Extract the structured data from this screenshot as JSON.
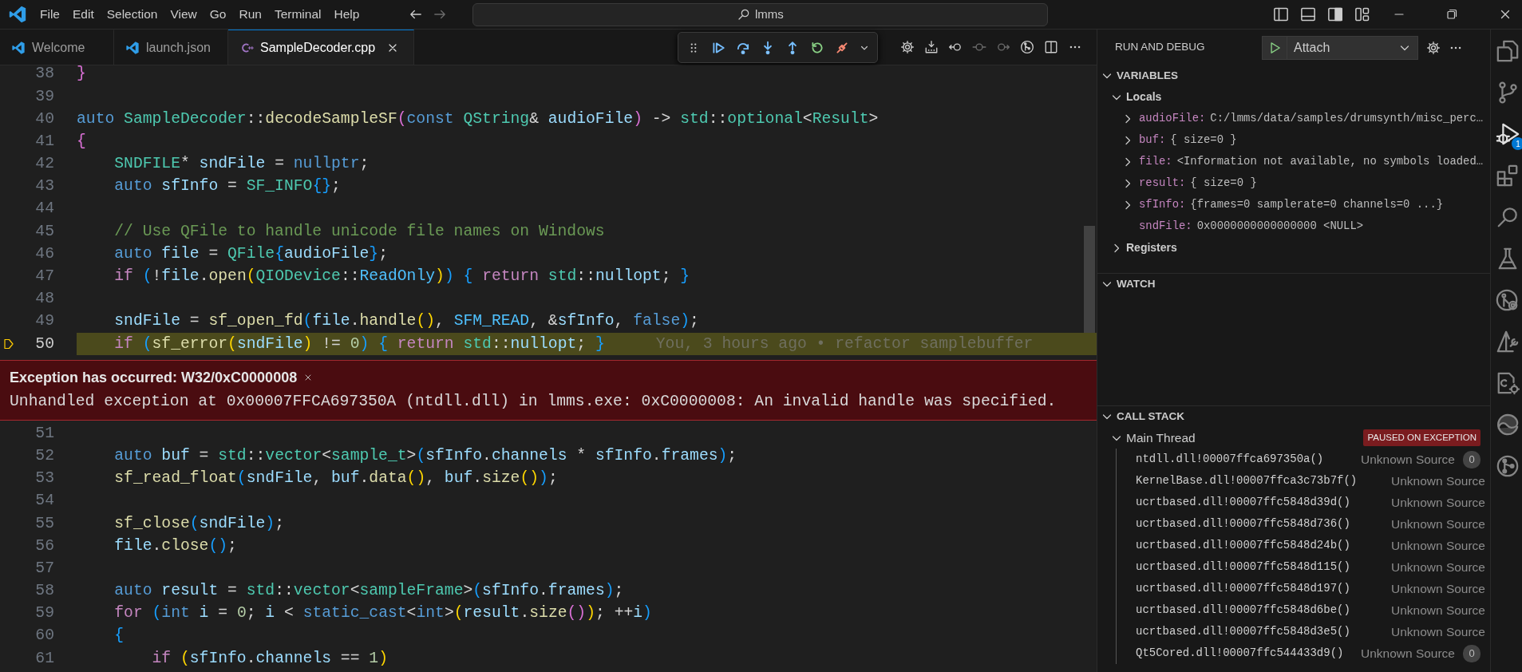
{
  "title_bar": {
    "menu": [
      "File",
      "Edit",
      "Selection",
      "View",
      "Go",
      "Run",
      "Terminal",
      "Help"
    ],
    "search": {
      "value": "lmms"
    }
  },
  "tabs": [
    {
      "label": "Welcome",
      "kind": "vscode",
      "selected": false
    },
    {
      "label": "launch.json",
      "kind": "vscode",
      "selected": false
    },
    {
      "label": "SampleDecoder.cpp",
      "kind": "cpp",
      "selected": true
    }
  ],
  "editor": {
    "lines": [
      {
        "number": "38",
        "current": false,
        "tokens": [
          {
            "kind": "b2",
            "text": "}"
          }
        ]
      },
      {
        "number": "39",
        "current": false
      },
      {
        "number": "40",
        "current": false,
        "tokens": [
          {
            "kind": "kw",
            "text": "auto"
          },
          {
            "kind": "type",
            "text": " SampleDecoder"
          },
          {
            "kind": "op",
            "text": "::"
          },
          {
            "kind": "fn",
            "text": "decodeSampleSF"
          },
          {
            "kind": "b2",
            "text": "("
          },
          {
            "kind": "kw",
            "text": "const"
          },
          {
            "kind": "type",
            "text": " QString"
          },
          {
            "kind": "op",
            "text": "& "
          },
          {
            "kind": "var",
            "text": "audioFile"
          },
          {
            "kind": "b2",
            "text": ")"
          },
          {
            "kind": "op",
            "text": " -> "
          },
          {
            "kind": "type",
            "text": "std"
          },
          {
            "kind": "op",
            "text": "::"
          },
          {
            "kind": "type",
            "text": "optional"
          },
          {
            "kind": "op",
            "text": "<"
          },
          {
            "kind": "type",
            "text": "Result"
          },
          {
            "kind": "op",
            "text": ">"
          }
        ]
      },
      {
        "number": "41",
        "current": false,
        "tokens": [
          {
            "kind": "b2",
            "text": "{"
          }
        ]
      },
      {
        "number": "42",
        "current": false,
        "tokens": [
          {
            "kind": "type",
            "text": "    SNDFILE"
          },
          {
            "kind": "op",
            "text": "* "
          },
          {
            "kind": "var",
            "text": "sndFile"
          },
          {
            "kind": "op",
            "text": " = "
          },
          {
            "kind": "kw",
            "text": "nullptr"
          },
          {
            "kind": "op",
            "text": ";"
          }
        ]
      },
      {
        "number": "43",
        "current": false,
        "tokens": [
          {
            "kind": "kw",
            "text": "    auto"
          },
          {
            "kind": "var",
            "text": " sfInfo"
          },
          {
            "kind": "op",
            "text": " = "
          },
          {
            "kind": "type",
            "text": "SF_INFO"
          },
          {
            "kind": "b3",
            "text": "{}"
          },
          {
            "kind": "op",
            "text": ";"
          }
        ]
      },
      {
        "number": "44",
        "current": false
      },
      {
        "number": "45",
        "current": false,
        "tokens": [
          {
            "kind": "com",
            "text": "    // Use QFile to handle unicode file names on Windows"
          }
        ]
      },
      {
        "number": "46",
        "current": false,
        "tokens": [
          {
            "kind": "kw",
            "text": "    auto"
          },
          {
            "kind": "var",
            "text": " file"
          },
          {
            "kind": "op",
            "text": " = "
          },
          {
            "kind": "type",
            "text": "QFile"
          },
          {
            "kind": "b3",
            "text": "{"
          },
          {
            "kind": "var",
            "text": "audioFile"
          },
          {
            "kind": "b3",
            "text": "}"
          },
          {
            "kind": "op",
            "text": ";"
          }
        ]
      },
      {
        "number": "47",
        "current": false,
        "tokens": [
          {
            "kind": "ctl",
            "text": "    if"
          },
          {
            "kind": "b3",
            "text": " ("
          },
          {
            "kind": "op",
            "text": "!"
          },
          {
            "kind": "var",
            "text": "file"
          },
          {
            "kind": "op",
            "text": "."
          },
          {
            "kind": "fn",
            "text": "open"
          },
          {
            "kind": "b1",
            "text": "("
          },
          {
            "kind": "type",
            "text": "QIODevice"
          },
          {
            "kind": "op",
            "text": "::"
          },
          {
            "kind": "enum",
            "text": "ReadOnly"
          },
          {
            "kind": "b1",
            "text": ")"
          },
          {
            "kind": "b3",
            "text": ")"
          },
          {
            "kind": "b3",
            "text": " {"
          },
          {
            "kind": "ctl",
            "text": " return"
          },
          {
            "kind": "type",
            "text": " std"
          },
          {
            "kind": "op",
            "text": "::"
          },
          {
            "kind": "var",
            "text": "nullopt"
          },
          {
            "kind": "op",
            "text": "; "
          },
          {
            "kind": "b3",
            "text": "}"
          }
        ]
      },
      {
        "number": "48",
        "current": false
      },
      {
        "number": "49",
        "current": false,
        "tokens": [
          {
            "kind": "var",
            "text": "    sndFile"
          },
          {
            "kind": "op",
            "text": " = "
          },
          {
            "kind": "fn",
            "text": "sf_open_fd"
          },
          {
            "kind": "b3",
            "text": "("
          },
          {
            "kind": "var",
            "text": "file"
          },
          {
            "kind": "op",
            "text": "."
          },
          {
            "kind": "fn",
            "text": "handle"
          },
          {
            "kind": "b1",
            "text": "()"
          },
          {
            "kind": "op",
            "text": ", "
          },
          {
            "kind": "enum",
            "text": "SFM_READ"
          },
          {
            "kind": "op",
            "text": ", &"
          },
          {
            "kind": "var",
            "text": "sfInfo"
          },
          {
            "kind": "op",
            "text": ", "
          },
          {
            "kind": "kw",
            "text": "false"
          },
          {
            "kind": "b3",
            "text": ")"
          },
          {
            "kind": "op",
            "text": ";"
          }
        ]
      },
      {
        "number": "50",
        "current": true,
        "annotation": "You, 3 hours ago • refactor samplebuffer",
        "exception": {
          "title": "Exception has occurred: W32/0xC0000008",
          "message": "Unhandled exception at 0x00007FFCA697350A (ntdll.dll) in lmms.exe: 0xC0000008: An invalid handle was specified."
        },
        "tokens": [
          {
            "kind": "ctl",
            "text": "    if"
          },
          {
            "kind": "b3",
            "text": " ("
          },
          {
            "kind": "fn",
            "text": "sf_error"
          },
          {
            "kind": "b1",
            "text": "("
          },
          {
            "kind": "var",
            "text": "sndFile"
          },
          {
            "kind": "b1",
            "text": ")"
          },
          {
            "kind": "op",
            "text": " != "
          },
          {
            "kind": "num",
            "text": "0"
          },
          {
            "kind": "b3",
            "text": ")"
          },
          {
            "kind": "b3",
            "text": " {"
          },
          {
            "kind": "ctl",
            "text": " return"
          },
          {
            "kind": "type",
            "text": " std"
          },
          {
            "kind": "op",
            "text": "::"
          },
          {
            "kind": "var",
            "text": "nullopt"
          },
          {
            "kind": "op",
            "text": "; "
          },
          {
            "kind": "b3",
            "text": "}"
          }
        ]
      },
      {
        "number": "51",
        "current": false
      },
      {
        "number": "52",
        "current": false,
        "tokens": [
          {
            "kind": "kw",
            "text": "    auto"
          },
          {
            "kind": "var",
            "text": " buf"
          },
          {
            "kind": "op",
            "text": " = "
          },
          {
            "kind": "type",
            "text": "std"
          },
          {
            "kind": "op",
            "text": "::"
          },
          {
            "kind": "type",
            "text": "vector"
          },
          {
            "kind": "op",
            "text": "<"
          },
          {
            "kind": "type",
            "text": "sample_t"
          },
          {
            "kind": "op",
            "text": ">"
          },
          {
            "kind": "b3",
            "text": "("
          },
          {
            "kind": "var",
            "text": "sfInfo"
          },
          {
            "kind": "op",
            "text": "."
          },
          {
            "kind": "var",
            "text": "channels"
          },
          {
            "kind": "op",
            "text": " * "
          },
          {
            "kind": "var",
            "text": "sfInfo"
          },
          {
            "kind": "op",
            "text": "."
          },
          {
            "kind": "var",
            "text": "frames"
          },
          {
            "kind": "b3",
            "text": ")"
          },
          {
            "kind": "op",
            "text": ";"
          }
        ]
      },
      {
        "number": "53",
        "current": false,
        "tokens": [
          {
            "kind": "fn",
            "text": "    sf_read_float"
          },
          {
            "kind": "b3",
            "text": "("
          },
          {
            "kind": "var",
            "text": "sndFile"
          },
          {
            "kind": "op",
            "text": ", "
          },
          {
            "kind": "var",
            "text": "buf"
          },
          {
            "kind": "op",
            "text": "."
          },
          {
            "kind": "fn",
            "text": "data"
          },
          {
            "kind": "b1",
            "text": "()"
          },
          {
            "kind": "op",
            "text": ", "
          },
          {
            "kind": "var",
            "text": "buf"
          },
          {
            "kind": "op",
            "text": "."
          },
          {
            "kind": "fn",
            "text": "size"
          },
          {
            "kind": "b1",
            "text": "()"
          },
          {
            "kind": "b3",
            "text": ")"
          },
          {
            "kind": "op",
            "text": ";"
          }
        ]
      },
      {
        "number": "54",
        "current": false
      },
      {
        "number": "55",
        "current": false,
        "tokens": [
          {
            "kind": "fn",
            "text": "    sf_close"
          },
          {
            "kind": "b3",
            "text": "("
          },
          {
            "kind": "var",
            "text": "sndFile"
          },
          {
            "kind": "b3",
            "text": ")"
          },
          {
            "kind": "op",
            "text": ";"
          }
        ]
      },
      {
        "number": "56",
        "current": false,
        "tokens": [
          {
            "kind": "var",
            "text": "    file"
          },
          {
            "kind": "op",
            "text": "."
          },
          {
            "kind": "fn",
            "text": "close"
          },
          {
            "kind": "b3",
            "text": "()"
          },
          {
            "kind": "op",
            "text": ";"
          }
        ]
      },
      {
        "number": "57",
        "current": false
      },
      {
        "number": "58",
        "current": false,
        "tokens": [
          {
            "kind": "kw",
            "text": "    auto"
          },
          {
            "kind": "var",
            "text": " result"
          },
          {
            "kind": "op",
            "text": " = "
          },
          {
            "kind": "type",
            "text": "std"
          },
          {
            "kind": "op",
            "text": "::"
          },
          {
            "kind": "type",
            "text": "vector"
          },
          {
            "kind": "op",
            "text": "<"
          },
          {
            "kind": "type",
            "text": "sampleFrame"
          },
          {
            "kind": "op",
            "text": ">"
          },
          {
            "kind": "b3",
            "text": "("
          },
          {
            "kind": "var",
            "text": "sfInfo"
          },
          {
            "kind": "op",
            "text": "."
          },
          {
            "kind": "var",
            "text": "frames"
          },
          {
            "kind": "b3",
            "text": ")"
          },
          {
            "kind": "op",
            "text": ";"
          }
        ]
      },
      {
        "number": "59",
        "current": false,
        "tokens": [
          {
            "kind": "ctl",
            "text": "    for"
          },
          {
            "kind": "b3",
            "text": " ("
          },
          {
            "kind": "kw",
            "text": "int"
          },
          {
            "kind": "var",
            "text": " i"
          },
          {
            "kind": "op",
            "text": " = "
          },
          {
            "kind": "num",
            "text": "0"
          },
          {
            "kind": "op",
            "text": "; "
          },
          {
            "kind": "var",
            "text": "i"
          },
          {
            "kind": "op",
            "text": " < "
          },
          {
            "kind": "kw",
            "text": "static_cast"
          },
          {
            "kind": "op",
            "text": "<"
          },
          {
            "kind": "kw",
            "text": "int"
          },
          {
            "kind": "op",
            "text": ">"
          },
          {
            "kind": "b1",
            "text": "("
          },
          {
            "kind": "var",
            "text": "result"
          },
          {
            "kind": "op",
            "text": "."
          },
          {
            "kind": "fn",
            "text": "size"
          },
          {
            "kind": "b2",
            "text": "()"
          },
          {
            "kind": "b1",
            "text": ")"
          },
          {
            "kind": "op",
            "text": "; ++"
          },
          {
            "kind": "var",
            "text": "i"
          },
          {
            "kind": "b3",
            "text": ")"
          }
        ]
      },
      {
        "number": "60",
        "current": false,
        "tokens": [
          {
            "kind": "b3",
            "text": "    {"
          }
        ]
      },
      {
        "number": "61",
        "current": false,
        "tokens": [
          {
            "kind": "ctl",
            "text": "        if"
          },
          {
            "kind": "b1",
            "text": " ("
          },
          {
            "kind": "var",
            "text": "sfInfo"
          },
          {
            "kind": "op",
            "text": "."
          },
          {
            "kind": "var",
            "text": "channels"
          },
          {
            "kind": "op",
            "text": " == "
          },
          {
            "kind": "num",
            "text": "1"
          },
          {
            "kind": "b1",
            "text": ")"
          }
        ]
      }
    ]
  },
  "run_and_debug": {
    "title": "RUN AND DEBUG",
    "configuration": "Attach"
  },
  "variables": {
    "title": "VARIABLES",
    "expanded": true,
    "scopes": [
      {
        "label": "Locals",
        "expanded": true,
        "children": [
          {
            "name": "audioFile:",
            "value": "C:/lmms/data/samples/drumsynth/misc_perc…",
            "expandable": true
          },
          {
            "name": "buf:",
            "value": "{ size=0 }",
            "expandable": true
          },
          {
            "name": "file:",
            "value": "<Information not available, no symbols loaded…",
            "expandable": true
          },
          {
            "name": "result:",
            "value": "{ size=0 }",
            "expandable": true
          },
          {
            "name": "sfInfo:",
            "value": "{frames=0 samplerate=0 channels=0 ...}",
            "expandable": true
          },
          {
            "name": "sndFile:",
            "value": "0x0000000000000000 <NULL>",
            "expandable": false
          }
        ]
      },
      {
        "label": "Registers",
        "expanded": false
      }
    ]
  },
  "watch": {
    "title": "WATCH",
    "expanded": true
  },
  "call_stack": {
    "title": "CALL STACK",
    "expanded": true,
    "threads": [
      {
        "name": "Main Thread",
        "status": "PAUSED ON EXCEPTION",
        "expanded": true,
        "frames": [
          {
            "function": "ntdll.dll!00007ffca697350a()",
            "source": "Unknown Source",
            "badge": "0"
          },
          {
            "function": "KernelBase.dll!00007ffca3c73b7f()",
            "source": "Unknown Source"
          },
          {
            "function": "ucrtbased.dll!00007ffc5848d39d()",
            "source": "Unknown Source"
          },
          {
            "function": "ucrtbased.dll!00007ffc5848d736()",
            "source": "Unknown Source"
          },
          {
            "function": "ucrtbased.dll!00007ffc5848d24b()",
            "source": "Unknown Source"
          },
          {
            "function": "ucrtbased.dll!00007ffc5848d115()",
            "source": "Unknown Source"
          },
          {
            "function": "ucrtbased.dll!00007ffc5848d197()",
            "source": "Unknown Source"
          },
          {
            "function": "ucrtbased.dll!00007ffc5848d6be()",
            "source": "Unknown Source"
          },
          {
            "function": "ucrtbased.dll!00007ffc5848d3e5()",
            "source": "Unknown Source"
          },
          {
            "function": "Qt5Cored.dll!00007ffc544433d9()",
            "source": "Unknown Source",
            "badge": "0"
          }
        ]
      }
    ]
  },
  "activity_bar": [
    {
      "kind": "files",
      "selected": false
    },
    {
      "kind": "branch",
      "selected": false
    },
    {
      "kind": "debug",
      "selected": true,
      "badge": "1"
    },
    {
      "kind": "extensions",
      "selected": false
    },
    {
      "kind": "search",
      "selected": false
    },
    {
      "kind": "flask",
      "selected": false
    },
    {
      "kind": "circle-branch",
      "selected": false
    },
    {
      "kind": "triangle-wrench",
      "selected": false
    },
    {
      "kind": "document-gear",
      "selected": false
    },
    {
      "kind": "swirl",
      "selected": false
    },
    {
      "kind": "circle-fork",
      "selected": false
    }
  ]
}
